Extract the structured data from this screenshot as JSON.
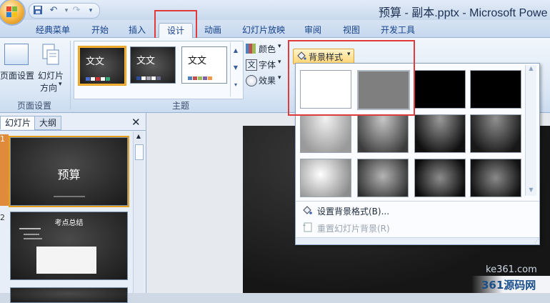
{
  "window": {
    "title": "预算 - 副本.pptx - Microsoft Powe"
  },
  "qat": {
    "save_icon": "save-icon",
    "undo_icon": "undo-icon",
    "redo_icon": "redo-icon"
  },
  "tabs": [
    {
      "label": "经典菜单"
    },
    {
      "label": "开始"
    },
    {
      "label": "插入"
    },
    {
      "label": "设计"
    },
    {
      "label": "动画"
    },
    {
      "label": "幻灯片放映"
    },
    {
      "label": "审阅"
    },
    {
      "label": "视图"
    },
    {
      "label": "开发工具"
    }
  ],
  "ribbon": {
    "page_setup": {
      "btn_page_setup": "页面设置",
      "btn_orient_1": "幻灯片",
      "btn_orient_2": "方向",
      "group_label": "页面设置"
    },
    "themes": {
      "thumb_text": "文文",
      "group_label": "主题",
      "colors_label": "颜色",
      "fonts_label": "字体",
      "effects_label": "效果"
    },
    "bg_styles_label": "背景样式"
  },
  "dropdown": {
    "format_bg": "设置背景格式(B)...",
    "reset_bg": "重置幻灯片背景(R)"
  },
  "panel": {
    "tab_slides": "幻灯片",
    "tab_outline": "大纲",
    "slide1": {
      "number": "1",
      "title": "预算"
    },
    "slide2": {
      "number": "2",
      "title": "考点总结"
    }
  },
  "watermark": {
    "line1": "ke361.com",
    "line2": "361源码网"
  },
  "colors": {
    "accent_red": "#e03b3b",
    "tab_text": "#15428b"
  }
}
